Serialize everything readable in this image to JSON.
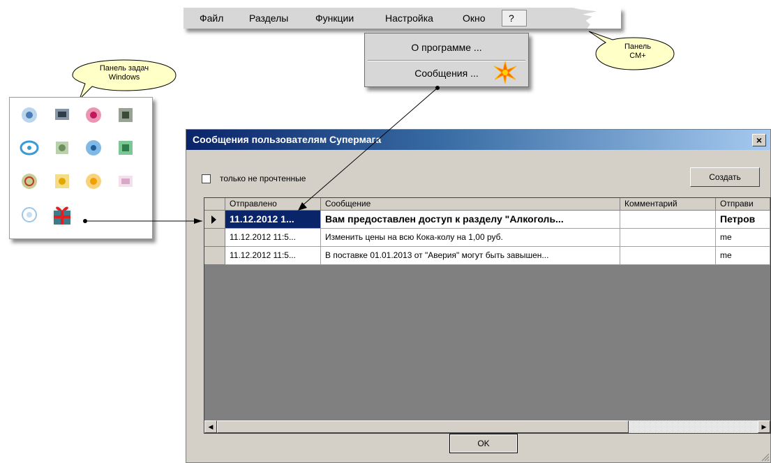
{
  "menu": {
    "items": [
      "Файл",
      "Разделы",
      "Функции",
      "Настройка",
      "Окно"
    ],
    "help": "?"
  },
  "dropdown": {
    "about": "О программе ...",
    "messages": "Сообщения ..."
  },
  "callouts": {
    "taskbar_line1": "Панель задач",
    "taskbar_line2": "Windows",
    "cm_line1": "Панель",
    "cm_line2": "СМ+"
  },
  "dialog": {
    "title": "Сообщения пользователям Супермага",
    "close": "×",
    "unread_only_label": "только не прочтенные",
    "unread_only_checked": false,
    "create_button": "Создать",
    "ok_button": "OK",
    "grid": {
      "columns": [
        "Отправлено",
        "Сообщение",
        "Комментарий",
        "Отправи"
      ],
      "rows": [
        {
          "sent": "11.12.2012 1...",
          "message": "Вам предоставлен доступ к разделу \"Алкоголь...",
          "comment": "",
          "sender": "Петров",
          "selected": true,
          "bold": true
        },
        {
          "sent": "11.12.2012 11:5...",
          "message": "Изменить цены на всю Кока-колу на 1,00 руб.",
          "comment": "",
          "sender": "me",
          "selected": false,
          "bold": false
        },
        {
          "sent": "11.12.2012 11:5...",
          "message": "В поставке 01.01.2013 от \"Аверия\" могут быть завышен...",
          "comment": "",
          "sender": "me",
          "selected": false,
          "bold": false
        }
      ]
    }
  },
  "colors": {
    "title_start": "#0a246a",
    "title_end": "#a6caf0",
    "dialog_bg": "#d4d0c8",
    "grid_bg": "#808080",
    "star": "#ff5a00"
  }
}
